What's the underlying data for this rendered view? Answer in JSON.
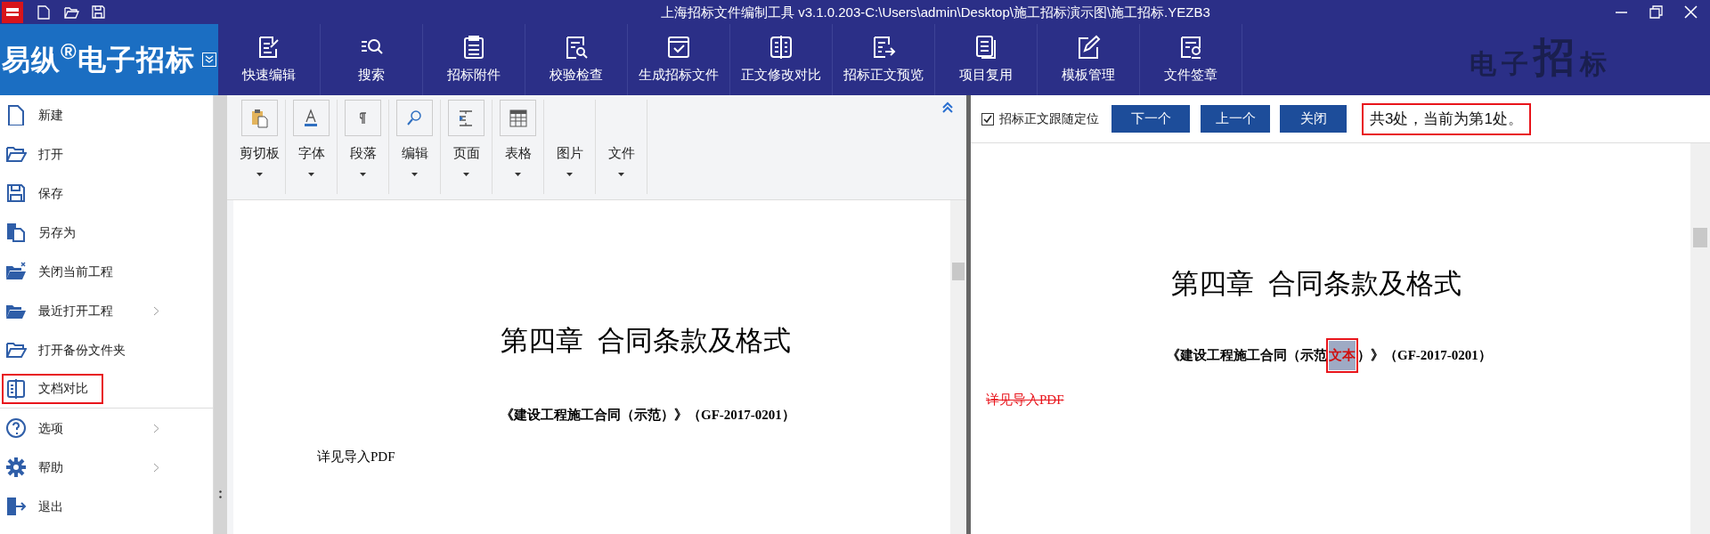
{
  "window": {
    "title": "上海招标文件编制工具 v3.1.0.203-C:\\Users\\admin\\Desktop\\施工招标演示图\\施工招标.YEZB3"
  },
  "brand": {
    "name": "易纵$^{®}$电子招标"
  },
  "toolbar": [
    {
      "label": "快速编辑"
    },
    {
      "label": "搜索"
    },
    {
      "label": "招标附件"
    },
    {
      "label": "校验检查"
    },
    {
      "label": "生成招标文件"
    },
    {
      "label": "正文修改对比"
    },
    {
      "label": "招标正文预览"
    },
    {
      "label": "项目复用"
    },
    {
      "label": "模板管理"
    },
    {
      "label": "文件签章"
    }
  ],
  "header_logo": [
    "电",
    "子",
    "招",
    "标"
  ],
  "sidebar": {
    "items": [
      {
        "label": "新建",
        "has_submenu": false,
        "highlighted": false,
        "separator_after": false
      },
      {
        "label": "打开",
        "has_submenu": false,
        "highlighted": false,
        "separator_after": false
      },
      {
        "label": "保存",
        "has_submenu": false,
        "highlighted": false,
        "separator_after": false
      },
      {
        "label": "另存为",
        "has_submenu": false,
        "highlighted": false,
        "separator_after": false
      },
      {
        "label": "关闭当前工程",
        "has_submenu": false,
        "highlighted": false,
        "separator_after": false
      },
      {
        "label": "最近打开工程",
        "has_submenu": true,
        "highlighted": false,
        "separator_after": false
      },
      {
        "label": "打开备份文件夹",
        "has_submenu": false,
        "highlighted": false,
        "separator_after": false
      },
      {
        "label": "文档对比",
        "has_submenu": false,
        "highlighted": true,
        "separator_after": true
      },
      {
        "label": "选项",
        "has_submenu": true,
        "highlighted": false,
        "separator_after": false
      },
      {
        "label": "帮助",
        "has_submenu": true,
        "highlighted": false,
        "separator_after": false
      },
      {
        "label": "退出",
        "has_submenu": false,
        "highlighted": false,
        "separator_after": false
      }
    ]
  },
  "ribbon": {
    "groups": [
      {
        "label": "剪切板",
        "has_icon": true
      },
      {
        "label": "字体",
        "has_icon": true
      },
      {
        "label": "段落",
        "has_icon": true
      },
      {
        "label": "编辑",
        "has_icon": true
      },
      {
        "label": "页面",
        "has_icon": true
      },
      {
        "label": "表格",
        "has_icon": true
      },
      {
        "label": "图片",
        "has_icon": false
      },
      {
        "label": "文件",
        "has_icon": false
      }
    ]
  },
  "left_document": {
    "heading": "第四章  合同条款及格式",
    "subtitle": "《建设工程施工合同（示范）》（GF-2017-0201）",
    "body": "详见导入PDF"
  },
  "compare_bar": {
    "checkbox": {
      "label": "招标正文跟随定位",
      "checked": true
    },
    "buttons": [
      "下一个",
      "上一个",
      "关闭"
    ],
    "message": {
      "text": "共3处，当前为第1处。",
      "highlighted": true
    }
  },
  "right_document": {
    "heading": "第四章  合同条款及格式",
    "subtitle_before": "《建设工程施工合同（示范",
    "subtitle_match": "文本",
    "subtitle_after": "）》（GF-2017-0201）",
    "match_highlighted": true,
    "body": "详见导入PDF",
    "body_deleted": true
  }
}
